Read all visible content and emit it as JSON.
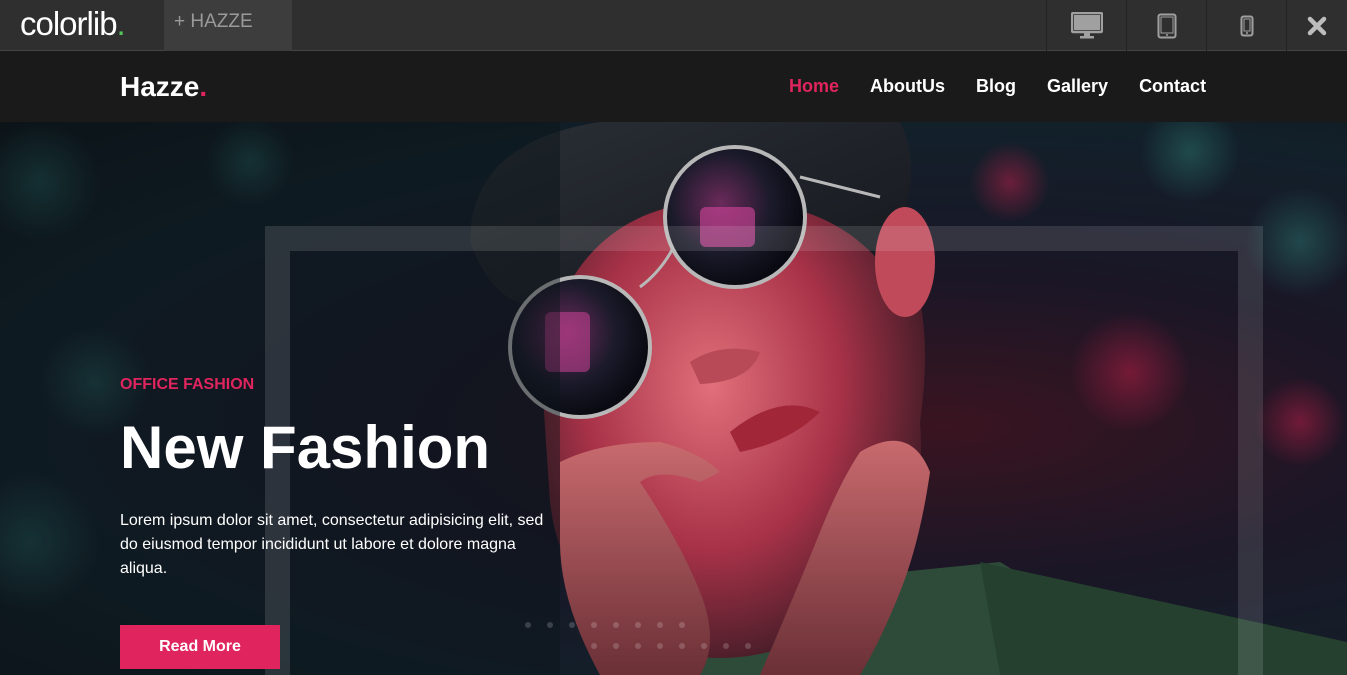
{
  "preview_bar": {
    "brand": "colorlib",
    "brand_dot": ".",
    "theme_tab": "+ HAZZE",
    "devices": [
      "desktop-icon",
      "tablet-icon",
      "mobile-icon"
    ],
    "close_icon": "close-icon"
  },
  "site": {
    "logo": "Hazze",
    "logo_dot": ".",
    "nav": [
      {
        "label": "Home",
        "active": true
      },
      {
        "label": "AboutUs",
        "active": false
      },
      {
        "label": "Blog",
        "active": false
      },
      {
        "label": "Gallery",
        "active": false
      },
      {
        "label": "Contact",
        "active": false
      }
    ]
  },
  "hero": {
    "eyebrow": "OFFICE FASHION",
    "headline": "New Fashion",
    "description": "Lorem ipsum dolor sit amet, consectetur adipisicing elit, sed do eiusmod tempor incididunt ut labore et dolore magna aliqua.",
    "button_label": "Read More"
  },
  "colors": {
    "accent": "#e0245e",
    "brand_dot": "#54c35a",
    "header_bg": "#1a1a1a",
    "preview_bg": "#2f2f2f"
  }
}
